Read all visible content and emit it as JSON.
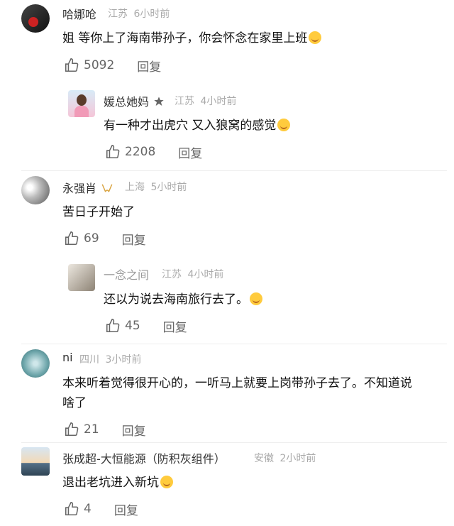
{
  "comments": [
    {
      "name": "哈娜呛",
      "location": "江苏",
      "time": "6小时前",
      "text": "姐 等你上了海南带孙子，你会怀念在家里上班",
      "likes": "5092",
      "reply_label": "回复"
    },
    {
      "name": "媛总她妈",
      "location": "江苏",
      "time": "4小时前",
      "text": "有一种才出虎穴 又入狼窝的感觉",
      "likes": "2208",
      "reply_label": "回复"
    },
    {
      "name": "永强肖",
      "location": "上海",
      "time": "5小时前",
      "text": "苦日子开始了",
      "likes": "69",
      "reply_label": "回复"
    },
    {
      "name": "一念之间",
      "location": "江苏",
      "time": "4小时前",
      "text": "还以为说去海南旅行去了。",
      "likes": "45",
      "reply_label": "回复"
    },
    {
      "name": "ni",
      "location": "四川",
      "time": "3小时前",
      "text": "本来听着觉得很开心的，一听马上就要上岗带孙子去了。不知道说啥了",
      "likes": "21",
      "reply_label": "回复"
    },
    {
      "name": "张成超-大恒能源（防积灰组件）",
      "location": "安徽",
      "time": "2小时前",
      "text": "退出老坑进入新坑",
      "likes": "4",
      "reply_label": "回复"
    }
  ],
  "colors": {
    "badge_gold": "#d9a441",
    "text": "#111111",
    "meta": "#aaaaaa"
  }
}
